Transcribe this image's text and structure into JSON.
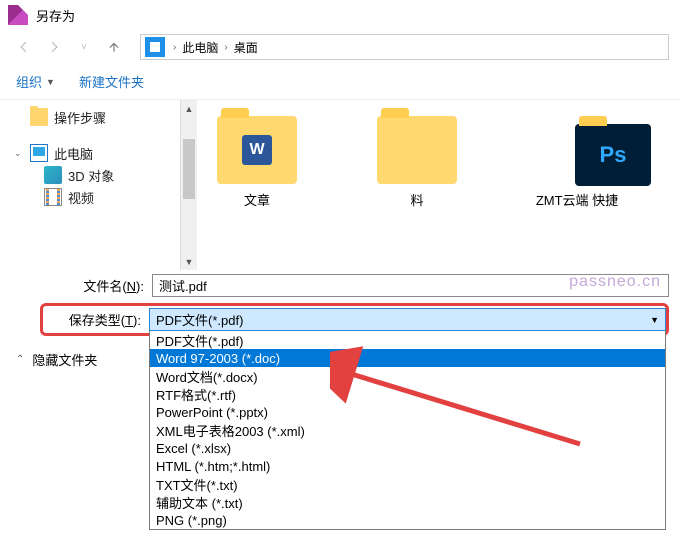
{
  "title": "另存为",
  "breadcrumb": {
    "root": "此电脑",
    "current": "桌面"
  },
  "toolbar": {
    "organize": "组织",
    "new_folder": "新建文件夹"
  },
  "tree": {
    "steps": "操作步骤",
    "pc": "此电脑",
    "obj3d": "3D 对象",
    "video": "视频"
  },
  "files": {
    "item1_partial": "文章",
    "item2_partial": "料",
    "item3_partial": "ZMT云端  快捷"
  },
  "form": {
    "filename_label_pre": "文件名(",
    "filename_label_key": "N",
    "filename_label_post": "):",
    "filename_value": "测试.pdf",
    "filetype_label_pre": "保存类型(",
    "filetype_label_key": "T",
    "filetype_label_post": "):",
    "filetype_value": "PDF文件(*.pdf)"
  },
  "dropdown_items": [
    "PDF文件(*.pdf)",
    "Word 97-2003 (*.doc)",
    "Word文档(*.docx)",
    "RTF格式(*.rtf)",
    "PowerPoint (*.pptx)",
    "XML电子表格2003 (*.xml)",
    "Excel (*.xlsx)",
    "HTML (*.htm;*.html)",
    "TXT文件(*.txt)",
    "辅助文本 (*.txt)",
    "PNG (*.png)"
  ],
  "dropdown_selected_index": 1,
  "hidden_folders": "隐藏文件夹",
  "watermark": "passneo.cn"
}
